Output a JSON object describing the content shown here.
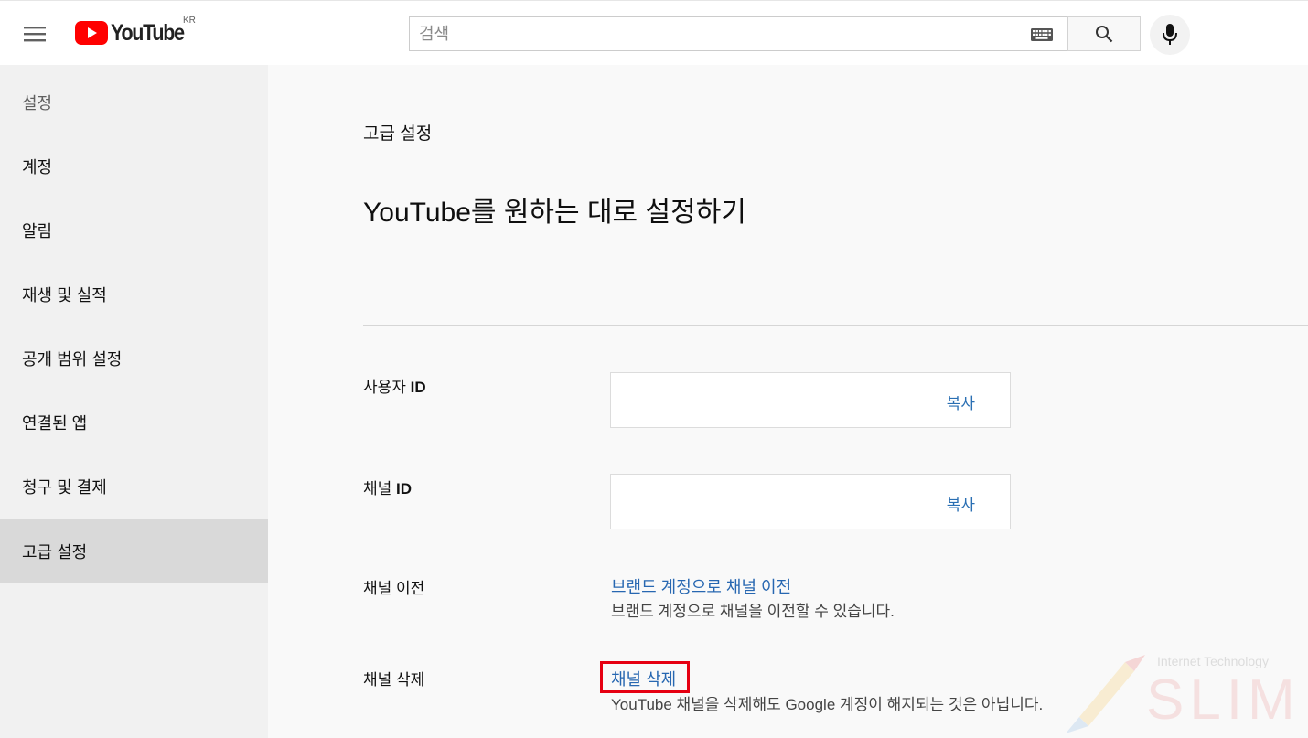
{
  "header": {
    "logo_text": "YouTube",
    "country_code": "KR",
    "search_placeholder": "검색",
    "icons": [
      "menu-icon",
      "youtube-logo-icon",
      "keyboard-icon",
      "search-icon",
      "mic-icon"
    ]
  },
  "sidebar": {
    "title": "설정",
    "items": [
      {
        "label": "계정",
        "active": false
      },
      {
        "label": "알림",
        "active": false
      },
      {
        "label": "재생 및 실적",
        "active": false
      },
      {
        "label": "공개 범위 설정",
        "active": false
      },
      {
        "label": "연결된 앱",
        "active": false
      },
      {
        "label": "청구 및 결제",
        "active": false
      },
      {
        "label": "고급 설정",
        "active": true
      }
    ]
  },
  "main": {
    "section_label": "고급 설정",
    "heading": "YouTube를 원하는 대로 설정하기",
    "user_id": {
      "label_prefix": "사용자 ",
      "label_bold": "ID",
      "value": "",
      "copy_label": "복사"
    },
    "channel_id": {
      "label_prefix": "채널 ",
      "label_bold": "ID",
      "value": "",
      "copy_label": "복사"
    },
    "channel_move": {
      "label": "채널 이전",
      "link": "브랜드 계정으로 채널 이전",
      "description": "브랜드 계정으로 채널을 이전할 수 있습니다."
    },
    "channel_delete": {
      "label": "채널 삭제",
      "link": "채널 삭제",
      "description": "YouTube 채널을 삭제해도 Google 계정이 해지되는 것은 아닙니다."
    }
  },
  "watermark": {
    "top_text": "Internet Technology",
    "word": "SLIM"
  },
  "colors": {
    "link": "#2767b1",
    "highlight": "#e60012",
    "logo_red": "#ff0000",
    "active_item": "#d9d9d9"
  }
}
